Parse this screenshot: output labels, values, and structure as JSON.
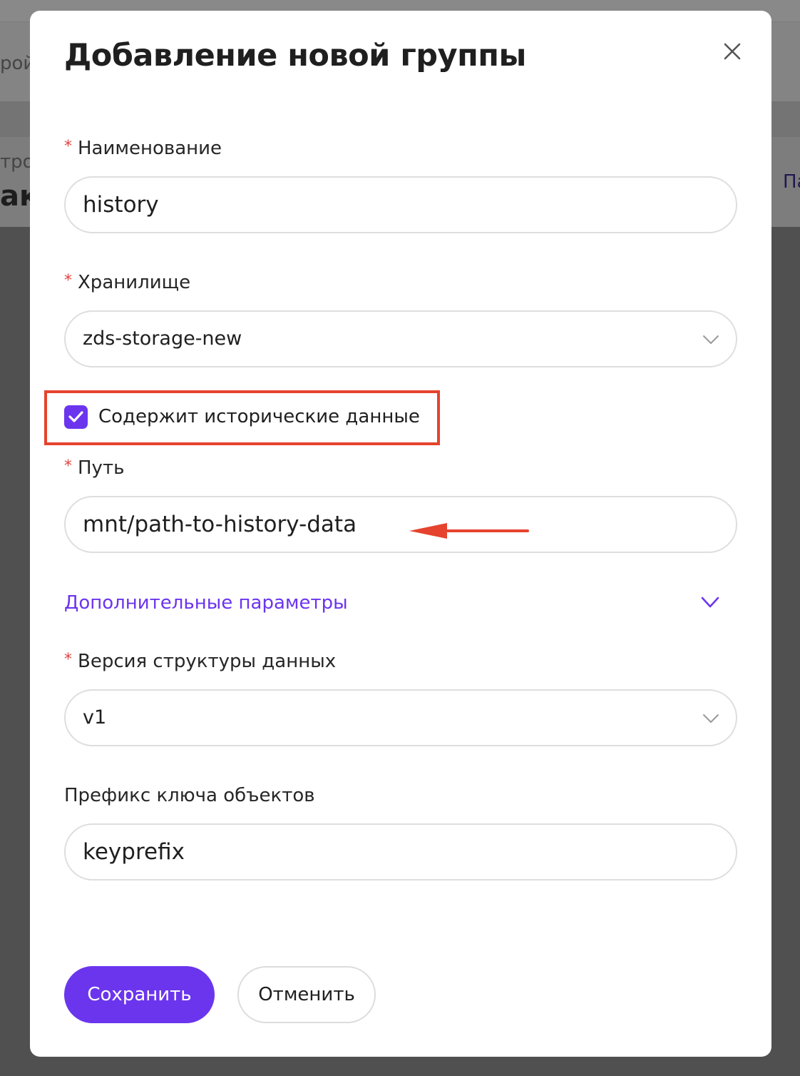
{
  "background": {
    "fragment_1": "рой",
    "fragment_2": "трой",
    "fragment_3": "ак",
    "fragment_4": "Па"
  },
  "modal": {
    "title": "Добавление новой группы",
    "close_icon": "close-icon"
  },
  "form": {
    "name": {
      "label": "Наименование",
      "required_mark": "*",
      "value": "history"
    },
    "storage": {
      "label": "Хранилище",
      "required_mark": "*",
      "value": "zds-storage-new",
      "icon": "chevron-down-icon"
    },
    "historical_checkbox": {
      "label": "Содержит исторические данные",
      "checked": true
    },
    "path": {
      "label": "Путь",
      "required_mark": "*",
      "value": "mnt/path-to-history-data"
    },
    "advanced": {
      "label": "Дополнительные параметры",
      "icon": "chevron-down-icon"
    },
    "data_structure_version": {
      "label": "Версия структуры данных",
      "required_mark": "*",
      "value": "v1",
      "icon": "chevron-down-icon"
    },
    "object_key_prefix": {
      "label": "Префикс ключа объектов",
      "value": "keyprefix"
    }
  },
  "actions": {
    "save_label": "Сохранить",
    "cancel_label": "Отменить"
  },
  "colors": {
    "accent": "#6b35ee",
    "required": "#e54242",
    "annotation": "#e5432d"
  }
}
